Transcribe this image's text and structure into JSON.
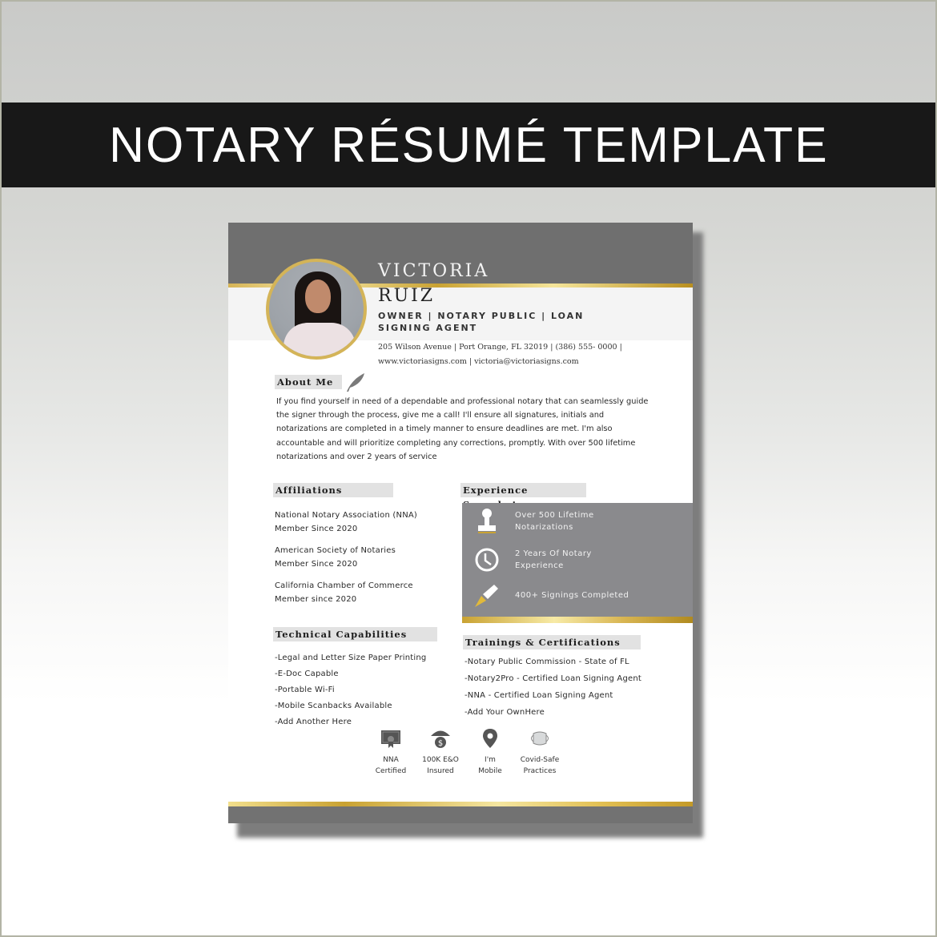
{
  "banner": {
    "title": "NOTARY RÉSUMÉ TEMPLATE"
  },
  "resume": {
    "first_name": "VICTORIA",
    "last_name": "RUIZ",
    "role": "OWNER | NOTARY PUBLIC | LOAN SIGNING AGENT",
    "contact_line1": "205 Wilson Avenue | Port Orange, FL 32019 | (386) 555- 0000 |",
    "contact_line2": "www.victoriasigns.com | victoria@victoriasigns.com",
    "about": {
      "title": "About Me",
      "icon": "quill-icon",
      "text": "If you find yourself in need of a dependable and professional notary that can seamlessly guide the signer through the process, give me a call! I'll ensure all signatures, initials and notarizations are completed in a timely manner to ensure deadlines are met. I'm also accountable and will prioritize completing any corrections, promptly. With over 500 lifetime notarizations and over 2 years of service"
    },
    "affiliations": {
      "title": "Affiliations",
      "items": [
        {
          "name": "National Notary Association (NNA)",
          "since": "Member Since 2020"
        },
        {
          "name": "American Society of Notaries",
          "since": "Member Since 2020"
        },
        {
          "name": "California Chamber of Commerce",
          "since": "Member since 2020"
        }
      ]
    },
    "experience": {
      "title": "Experience Snapshot",
      "items": [
        {
          "icon": "notary-stamp-icon",
          "line1": "Over 500 Lifetime",
          "line2": "Notarizations"
        },
        {
          "icon": "clock-icon",
          "line1": "2 Years Of Notary",
          "line2": "Experience"
        },
        {
          "icon": "fountain-pen-icon",
          "line1": "400+ Signings Completed",
          "line2": ""
        }
      ]
    },
    "technical": {
      "title": "Technical Capabilities",
      "items": [
        "-Legal and Letter Size Paper Printing",
        "-E-Doc Capable",
        "-Portable Wi-Fi",
        "-Mobile Scanbacks Available",
        "-Add Another Here"
      ]
    },
    "trainings": {
      "title": "Trainings & Certifications",
      "items": [
        "-Notary Public Commission - State of FL",
        "-Notary2Pro - Certified Loan Signing Agent",
        "-NNA - Certified Loan Signing Agent",
        "-Add Your OwnHere"
      ]
    },
    "badges": [
      {
        "icon": "certificate-icon",
        "line1": "NNA",
        "line2": "Certified"
      },
      {
        "icon": "insurance-umbrella-icon",
        "line1": "100K E&O",
        "line2": "Insured"
      },
      {
        "icon": "location-pin-icon",
        "line1": "I'm",
        "line2": "Mobile"
      },
      {
        "icon": "face-mask-icon",
        "line1": "Covid-Safe",
        "line2": "Practices"
      }
    ],
    "colors": {
      "header_gray": "#6f6f6f",
      "panel_gray": "#8a8a8d",
      "gold": "#d4b458",
      "banner_black": "#181818"
    }
  }
}
